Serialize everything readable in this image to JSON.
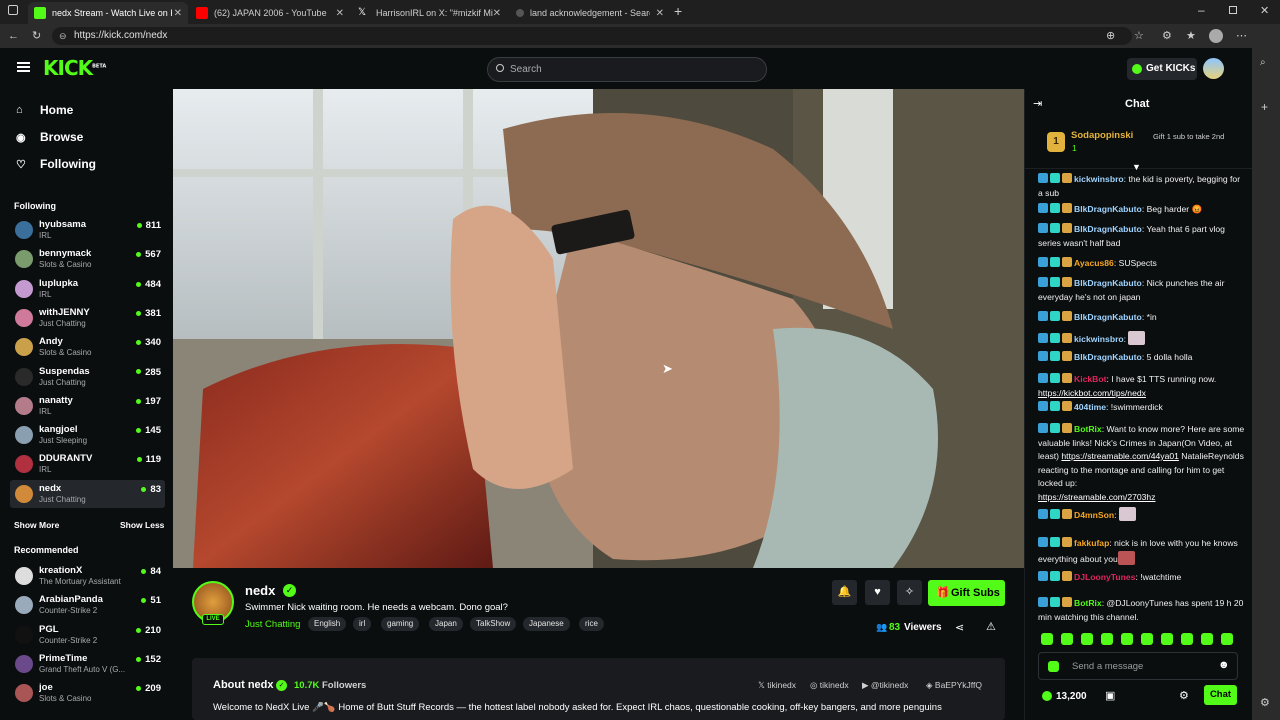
{
  "browser": {
    "tabs": [
      {
        "title": "nedx Stream - Watch Live on Kick",
        "favicon_color": "#53fc18"
      },
      {
        "title": "(62) JAPAN 2006 - YouTube",
        "favicon_color": "#ff0000"
      },
      {
        "title": "HarrisonIRL on X: \"#mizkif Mizkif",
        "favicon_color": "#ffffff"
      },
      {
        "title": "land acknowledgement - Search",
        "favicon_color": "#777777"
      }
    ],
    "url": "https://kick.com/nedx"
  },
  "header": {
    "logo": "KICK",
    "logo_badge": "BETA",
    "search_placeholder": "Search",
    "get_kicks": "Get KICKs"
  },
  "sidebar": {
    "nav": [
      {
        "label": "Home",
        "icon": "home-icon",
        "glyph": "⌂"
      },
      {
        "label": "Browse",
        "icon": "browse-icon",
        "glyph": "◉"
      },
      {
        "label": "Following",
        "icon": "heart-icon",
        "glyph": "♡"
      }
    ],
    "following_title": "Following",
    "following": [
      {
        "name": "hyubsama",
        "category": "IRL",
        "viewers": "811",
        "color": "#3b6f9b"
      },
      {
        "name": "bennymack",
        "category": "Slots & Casino",
        "viewers": "567",
        "color": "#7a9b6b"
      },
      {
        "name": "luplupka",
        "category": "IRL",
        "viewers": "484",
        "color": "#c59ad0"
      },
      {
        "name": "withJENNY",
        "category": "Just Chatting",
        "viewers": "381",
        "color": "#d07a9b"
      },
      {
        "name": "Andy",
        "category": "Slots & Casino",
        "viewers": "340",
        "color": "#caa04a"
      },
      {
        "name": "Suspendas",
        "category": "Just Chatting",
        "viewers": "285",
        "color": "#2a2a2a"
      },
      {
        "name": "nanatty",
        "category": "IRL",
        "viewers": "197",
        "color": "#b47b8a"
      },
      {
        "name": "kangjoel",
        "category": "Just Sleeping",
        "viewers": "145",
        "color": "#8aa0b0"
      },
      {
        "name": "DDURANTV",
        "category": "IRL",
        "viewers": "119",
        "color": "#b03040"
      },
      {
        "name": "nedx",
        "category": "Just Chatting",
        "viewers": "83",
        "color": "#d08a3a"
      }
    ],
    "show_more": "Show More",
    "show_less": "Show Less",
    "recommended_title": "Recommended",
    "recommended": [
      {
        "name": "kreationX",
        "category": "The Mortuary Assistant",
        "viewers": "84",
        "color": "#ddd"
      },
      {
        "name": "ArabianPanda",
        "category": "Counter-Strike 2",
        "viewers": "51",
        "color": "#9ab"
      },
      {
        "name": "PGL",
        "category": "Counter-Strike 2",
        "viewers": "210",
        "color": "#111"
      },
      {
        "name": "PrimeTime",
        "category": "Grand Theft Auto V (G...",
        "viewers": "152",
        "color": "#6a4a8a"
      },
      {
        "name": "joe",
        "category": "Slots & Casino",
        "viewers": "209",
        "color": "#a55"
      }
    ]
  },
  "stream": {
    "channel": "nedx",
    "title": "Swimmer Nick waiting room. He needs a webcam. Dono goal?",
    "category": "Just Chatting",
    "tags": [
      "English",
      "irl",
      "gaming",
      "Japan",
      "TalkShow",
      "Japanese",
      "rice"
    ],
    "live_label": "LIVE",
    "gift_subs": "Gift Subs",
    "viewers": "83",
    "viewers_label": "Viewers"
  },
  "about": {
    "title": "About nedx",
    "followers_count": "10.7K",
    "followers_label": "Followers",
    "socials": [
      "tikinedx",
      "tikinedx",
      "@tikinedx",
      "BaEPYkJffQ"
    ],
    "description": "Welcome to NedX Live 🎤🍗 Home of Butt Stuff Records — the hottest label nobody asked for. Expect IRL chaos, questionable cooking, off-key bangers, and more penguins"
  },
  "chat": {
    "title": "Chat",
    "leader_name": "Sodapopinski",
    "leader_rank": "1",
    "leader_count": "1",
    "gift_prompt": "Gift 1 sub to take 2nd",
    "messages": [
      {
        "user": "kickwinsbro",
        "color": "#9fd4ff",
        "text": "the kid is poverty, begging for a sub"
      },
      {
        "user": "BlkDragnKabuto",
        "color": "#9fd4ff",
        "text": "Beg harder 😡"
      },
      {
        "user": "BlkDragnKabuto",
        "color": "#9fd4ff",
        "text": "Yeah that 6 part vlog series wasn't half bad"
      },
      {
        "user": "Ayacus86",
        "color": "#f5a623",
        "text": "SUSpects"
      },
      {
        "user": "BlkDragnKabuto",
        "color": "#9fd4ff",
        "text": "Nick punches the air everyday he's not on japan"
      },
      {
        "user": "BlkDragnKabuto",
        "color": "#9fd4ff",
        "text": "*in"
      },
      {
        "user": "kickwinsbro",
        "color": "#9fd4ff",
        "text": ""
      },
      {
        "user": "BlkDragnKabuto",
        "color": "#9fd4ff",
        "text": "5 dolla holla"
      },
      {
        "user": "KickBot",
        "color": "#e0245e",
        "text": "I have $1 TTS running now.",
        "link": "https://kickbot.com/tips/nedx"
      },
      {
        "user": "404time",
        "color": "#9fd4ff",
        "text": "!swimmerdick"
      },
      {
        "user": "BotRix",
        "color": "#53fc18",
        "text": "Want to know more? Here are some valuable links! Nick's Crimes in Japan(On Video, at least)",
        "link": "https://streamable.com/44ya01",
        "text2": "NatalieReynolds reacting to the montage and calling for him to get locked up:",
        "link2": "https://streamable.com/2703hz"
      },
      {
        "user": "D4mnSon",
        "color": "#f5a623",
        "text": ""
      },
      {
        "user": "fakkufap",
        "color": "#f5a623",
        "text": "nick is in love with you he knows everything about you"
      },
      {
        "user": "DJLoonyTunes",
        "color": "#e0245e",
        "text": "!watchtime"
      },
      {
        "user": "BotRix",
        "color": "#53fc18",
        "text": "@DJLoonyTunes has spent 19 h 20 min watching this channel."
      }
    ],
    "send_placeholder": "Send a message",
    "kicks_balance": "13,200",
    "chat_button": "Chat"
  },
  "colors": {
    "accent": "#53fc18",
    "bg": "#0b0e0f",
    "panel": "#24272c"
  }
}
